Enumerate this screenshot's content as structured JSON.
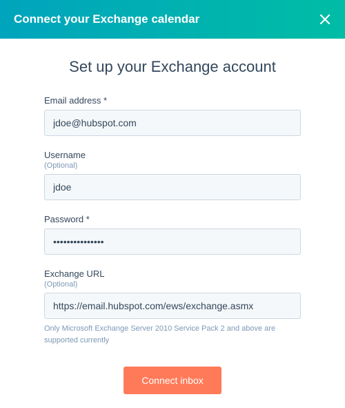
{
  "header": {
    "title": "Connect your Exchange calendar"
  },
  "main": {
    "title": "Set up your Exchange account",
    "fields": {
      "email": {
        "label": "Email address *",
        "value": "jdoe@hubspot.com"
      },
      "username": {
        "label": "Username",
        "optional": "(Optional)",
        "value": "jdoe"
      },
      "password": {
        "label": "Password *",
        "value": "•••••••••••••••"
      },
      "exchange_url": {
        "label": "Exchange URL",
        "optional": "(Optional)",
        "value": "https://email.hubspot.com/ews/exchange.asmx",
        "helper": "Only Microsoft Exchange Server 2010 Service Pack 2 and above are supported currently"
      }
    },
    "submit_label": "Connect inbox"
  }
}
